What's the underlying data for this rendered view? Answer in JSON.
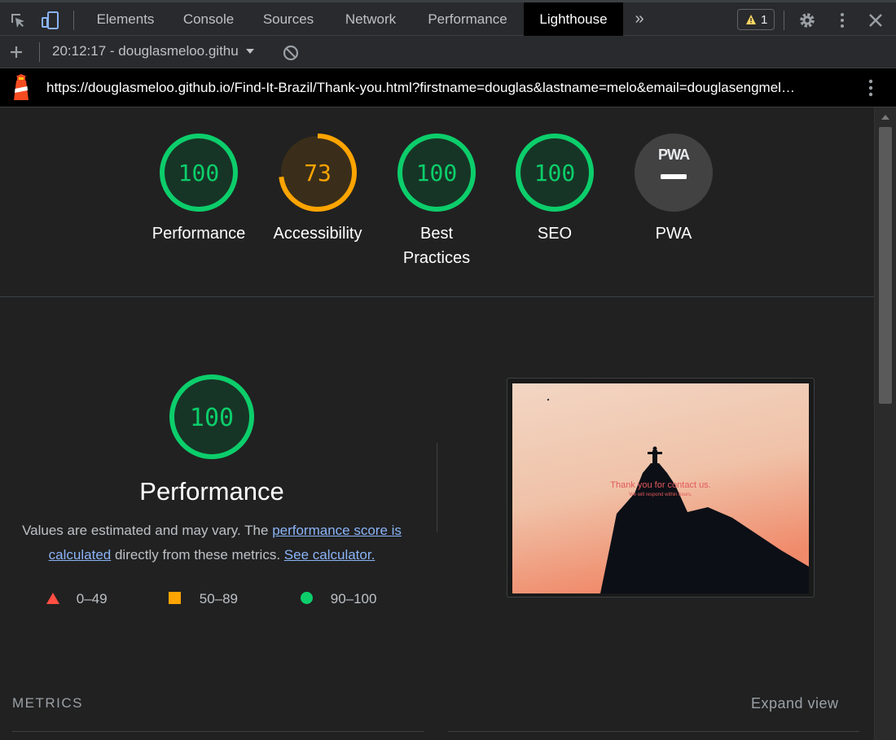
{
  "devtools": {
    "tabs": [
      "Elements",
      "Console",
      "Sources",
      "Network",
      "Performance",
      "Lighthouse"
    ],
    "active_tab": "Lighthouse",
    "more_tabs_icon": "double-chevron-right-icon",
    "warning_count": "1",
    "icons": [
      "inspect-element-icon",
      "device-toolbar-icon",
      "warning-icon",
      "gear-icon",
      "kebab-menu-icon",
      "close-icon"
    ]
  },
  "toolbar": {
    "report_select": "20:12:17 - douglasmeloo.githu",
    "icons": [
      "plus-icon",
      "chevron-down-icon",
      "clear-icon"
    ]
  },
  "urlbar": {
    "url": "https://douglasmeloo.github.io/Find-It-Brazil/Thank-you.html?firstname=douglas&lastname=melo&email=douglasengmel…",
    "icons": [
      "lighthouse-logo-icon",
      "kebab-menu-icon"
    ]
  },
  "scores": [
    {
      "label": "Performance",
      "score": "100",
      "color": "#0cce6b"
    },
    {
      "label": "Accessibility",
      "score": "73",
      "color": "#ffa400"
    },
    {
      "label": "Best Practices",
      "score": "100",
      "color": "#0cce6b"
    },
    {
      "label": "SEO",
      "score": "100",
      "color": "#0cce6b"
    },
    {
      "label": "PWA",
      "badge": "PWA",
      "color": "#9aa0a6"
    }
  ],
  "performance": {
    "score": "100",
    "title": "Performance",
    "desc_prefix": "Values are estimated and may vary. The ",
    "link_score": "performance score is calculated",
    "desc_middle": " directly from these metrics. ",
    "link_calc": "See calculator.",
    "legend": [
      {
        "range": "0–49",
        "color": "#ff4e42",
        "shape": "triangle"
      },
      {
        "range": "50–89",
        "color": "#ffa400",
        "shape": "square"
      },
      {
        "range": "90–100",
        "color": "#0cce6b",
        "shape": "circle"
      }
    ],
    "screenshot": {
      "caption": "Thank you for contact us.",
      "subcaption": "We will respond within hours."
    }
  },
  "metrics": {
    "heading": "METRICS",
    "expand_label": "Expand view"
  }
}
